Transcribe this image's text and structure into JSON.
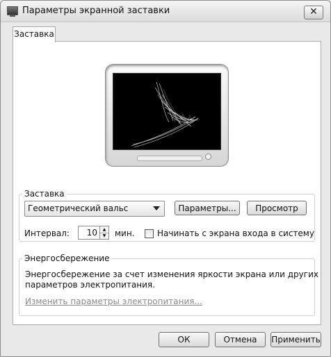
{
  "window": {
    "title": "Параметры экранной заставки"
  },
  "tabs": [
    {
      "label": "Заставка"
    }
  ],
  "screensaver": {
    "group_label": "Заставка",
    "selected": "Геометрический вальс",
    "settings_button": "Параметры...",
    "preview_button": "Просмотр",
    "interval_label": "Интервал:",
    "interval_value": "10",
    "interval_unit": "мин.",
    "logon_checkbox_label": "Начинать с экрана входа в систему",
    "logon_checked": false
  },
  "power": {
    "group_label": "Энергосбережение",
    "description_line1": "Энергосбережение за счет изменения яркости экрана или других",
    "description_line2": "параметров электропитания.",
    "link": "Изменить параметры электропитания..."
  },
  "buttons": {
    "ok": "ОК",
    "cancel": "Отмена",
    "apply": "Применить"
  }
}
